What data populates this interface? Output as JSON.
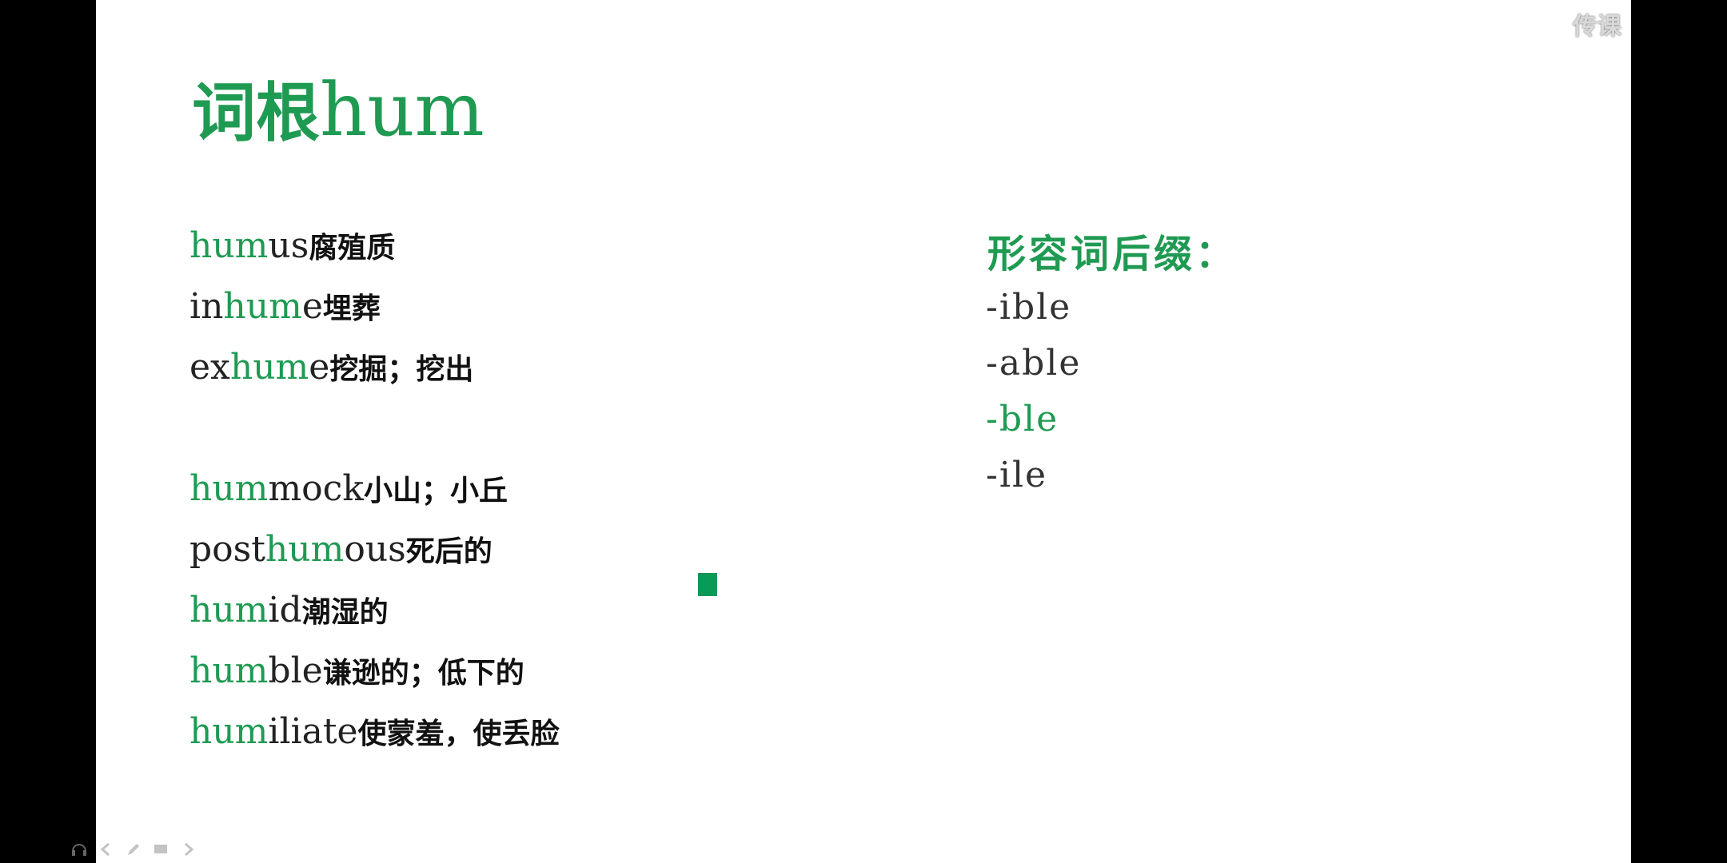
{
  "watermark": "传课",
  "title": {
    "cn": "词根",
    "en": "hum"
  },
  "words": [
    {
      "pre": "",
      "root": "hum",
      "post": "us",
      "meaning": "腐殖质"
    },
    {
      "pre": "in",
      "root": "hum",
      "post": "e",
      "meaning": "埋葬"
    },
    {
      "pre": "ex",
      "root": "hum",
      "post": "e",
      "meaning": "挖掘；挖出"
    },
    {
      "pre": "",
      "root": "hum",
      "post": "mock",
      "meaning": "小山；小丘"
    },
    {
      "pre": "post",
      "root": "hum",
      "post": "ous",
      "meaning": "死后的"
    },
    {
      "pre": "",
      "root": "hum",
      "post": "id",
      "meaning": "潮湿的"
    },
    {
      "pre": "",
      "root": "hum",
      "post": "ble",
      "meaning": "谦逊的；低下的"
    },
    {
      "pre": "",
      "root": "hum",
      "post": "iliate",
      "meaning": "使蒙羞，使丢脸"
    }
  ],
  "suffix_title": "形容词后缀：",
  "suffixes": [
    "-ible",
    "-able",
    "-ble",
    "-ile"
  ],
  "colors": {
    "accent": "#1f9a52",
    "marker": "#0a9a57"
  },
  "toolbar_icons": [
    "headphones-icon",
    "arrow-left-icon",
    "pencil-icon",
    "screen-icon",
    "arrow-right-icon"
  ]
}
